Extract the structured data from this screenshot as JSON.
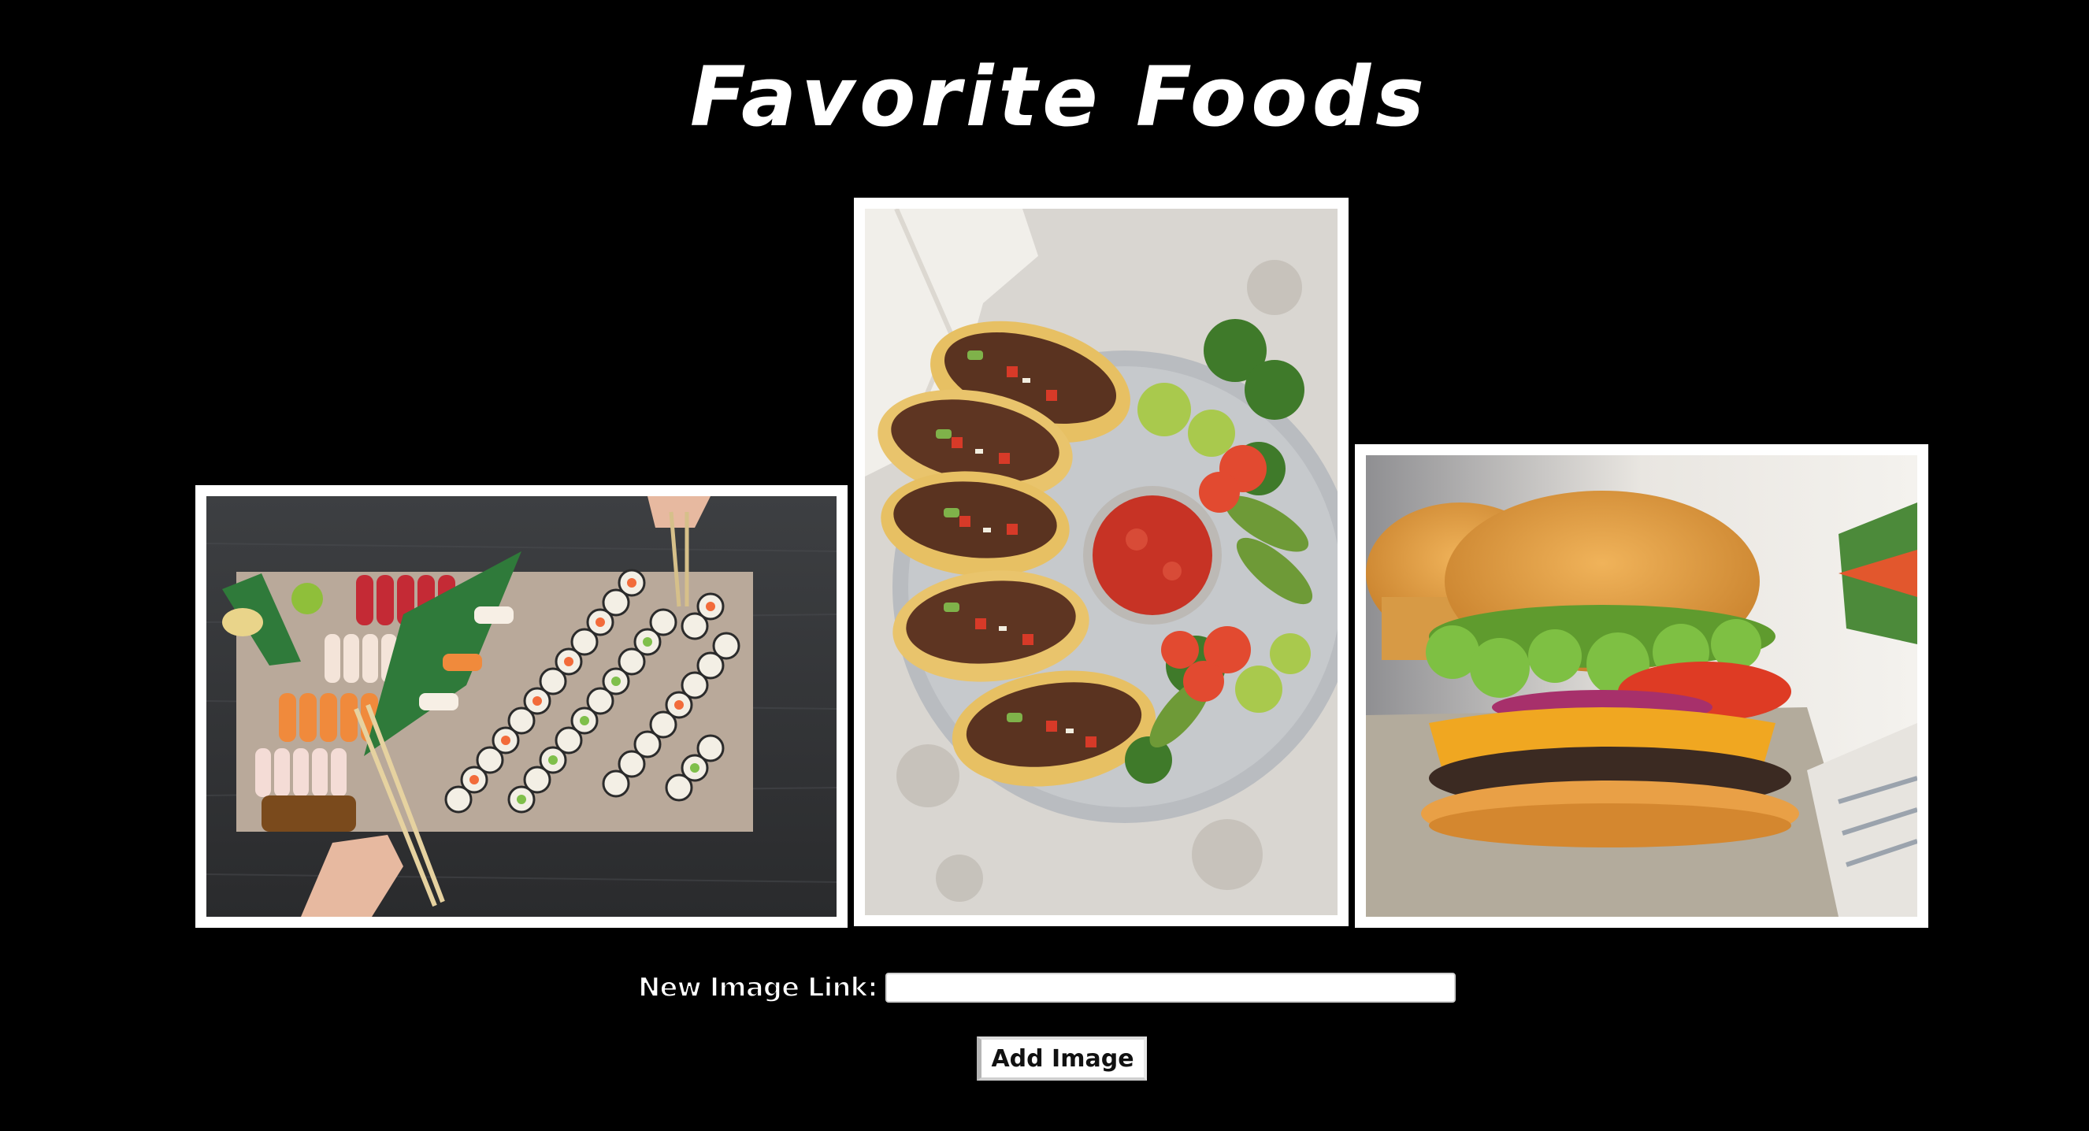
{
  "page": {
    "title": "Favorite Foods"
  },
  "gallery": {
    "images": [
      {
        "alt": "sushi",
        "icon": "sushi-photo"
      },
      {
        "alt": "tacos",
        "icon": "tacos-photo"
      },
      {
        "alt": "burger",
        "icon": "burger-photo"
      }
    ]
  },
  "form": {
    "label": "New Image Link:",
    "input_value": "",
    "input_placeholder": "",
    "button_label": "Add Image"
  },
  "colors": {
    "background": "#000000",
    "frame": "#ffffff",
    "text": "#ffffff"
  }
}
